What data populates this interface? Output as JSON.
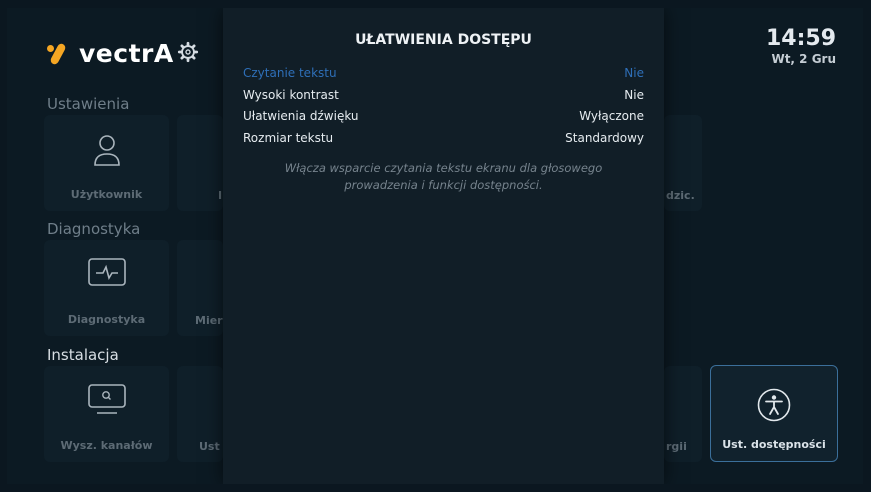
{
  "header": {
    "brand": "vectrA",
    "time": "14:59",
    "date": "Wt, 2 Gru"
  },
  "sections": [
    {
      "title": "Ustawienia"
    },
    {
      "title": "Diagnostyka"
    },
    {
      "title": "Instalacja"
    }
  ],
  "tiles": {
    "uzytkownik": {
      "label": "Użytkownik",
      "icon": "user-icon"
    },
    "diagnostyka": {
      "label": "Diagnostyka",
      "icon": "pulse-monitor-icon"
    },
    "wysz_kanalow": {
      "label": "Wysz. kanałów",
      "icon": "tv-search-icon"
    },
    "ust_dostepnosci": {
      "label": "Ust. dostępności",
      "icon": "accessibility-icon"
    }
  },
  "partial_labels": {
    "row1_left": "I",
    "row1_right": "dzic.",
    "row2_left": "Mier",
    "row3_left": "Ust",
    "row3_right": "rgii"
  },
  "modal": {
    "title": "UŁATWIENIA DOSTĘPU",
    "options": [
      {
        "label": "Czytanie tekstu",
        "value": "Nie"
      },
      {
        "label": "Wysoki kontrast",
        "value": "Nie"
      },
      {
        "label": "Ułatwienia dźwięku",
        "value": "Wyłączone"
      },
      {
        "label": "Rozmiar tekstu",
        "value": "Standardowy"
      }
    ],
    "description": "Włącza wsparcie czytania tekstu ekranu dla głosowego prowadzenia i funkcji dostępności."
  },
  "colors": {
    "accent": "#2e6fb8",
    "brand": "#f5a623"
  }
}
